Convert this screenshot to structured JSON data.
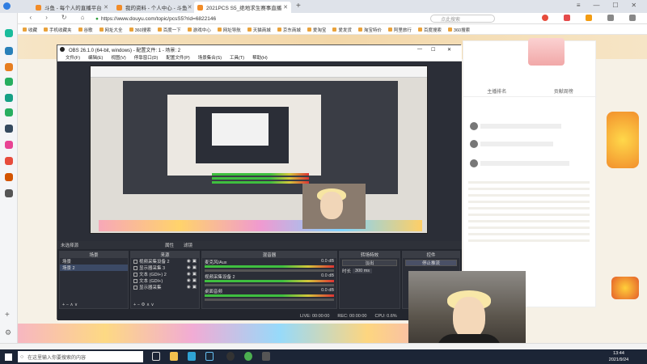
{
  "browser": {
    "tabs": [
      {
        "label": "斗鱼 - 每个人的直播平台",
        "color": "#f28c28"
      },
      {
        "label": "我的资料 - 个人中心 - 斗鱼",
        "color": "#f28c28"
      },
      {
        "label": "2021PCS S5_绝地求生赛事直播",
        "color": "#f28c28"
      }
    ],
    "new_tab": "+",
    "url": "https://www.douyu.com/topic/pcsS5?rid=6822146",
    "search_placeholder": "点此搜索",
    "bookmarks": [
      "收藏",
      "手机收藏夹",
      "谷歌",
      "网址大全",
      "360搜索",
      "百度一下",
      "游戏中心",
      "网址导航",
      "天猫商城",
      "京东商城",
      "爱淘宝",
      "爱发货",
      "淘宝特价",
      "阿里旅行",
      "百度搜索",
      "360搜索"
    ]
  },
  "obs": {
    "title": "OBS 26.1.0 (64-bit, windows) - 配置文件: 1 - 场景: 2",
    "menu": [
      "文件(F)",
      "编辑(E)",
      "视图(V)",
      "停靠窗口(D)",
      "配置文件(P)",
      "场景集合(S)",
      "工具(T)",
      "帮助(H)"
    ],
    "source_bar": "未选择源",
    "source_bar_props": "属性",
    "source_bar_filters": "滤镜",
    "scenes_header": "场景",
    "scenes": [
      "场景",
      "场景 2"
    ],
    "sources_header": "来源",
    "sources": [
      "视频采集设备 2",
      "显示器采集 3",
      "文本 (GDI+) 2",
      "文本 (GDI+)",
      "显示器采集"
    ],
    "mixer_header": "混音器",
    "mixer": [
      {
        "name": "麦克风/Aux",
        "db": "0.0 dB"
      },
      {
        "name": "视频采集设备 2",
        "db": "0.0 dB"
      },
      {
        "name": "桌面音频",
        "db": "0.0 dB"
      }
    ],
    "transitions_header": "转场特效",
    "transition": "淡出",
    "duration_label": "时长",
    "duration": "300 ms",
    "controls_header": "控件",
    "control_start": "停止推流",
    "status": {
      "live": "LIVE: 00:00:00",
      "rec": "REC: 00:00:00",
      "cpu": "CPU: 0.6%"
    },
    "minimize": "—",
    "maximize": "☐",
    "close": "✕"
  },
  "stream": {
    "anchor_label": "主播排名",
    "gift_label": "贡献周榜"
  },
  "taskbar": {
    "search": "在这里输入你要搜索的内容",
    "time": "13:44",
    "date": "2021/9/24"
  },
  "colors": {
    "douyu_orange": "#f28c28",
    "obs_bg": "#2b2e37",
    "taskbar": "#1c2536"
  }
}
